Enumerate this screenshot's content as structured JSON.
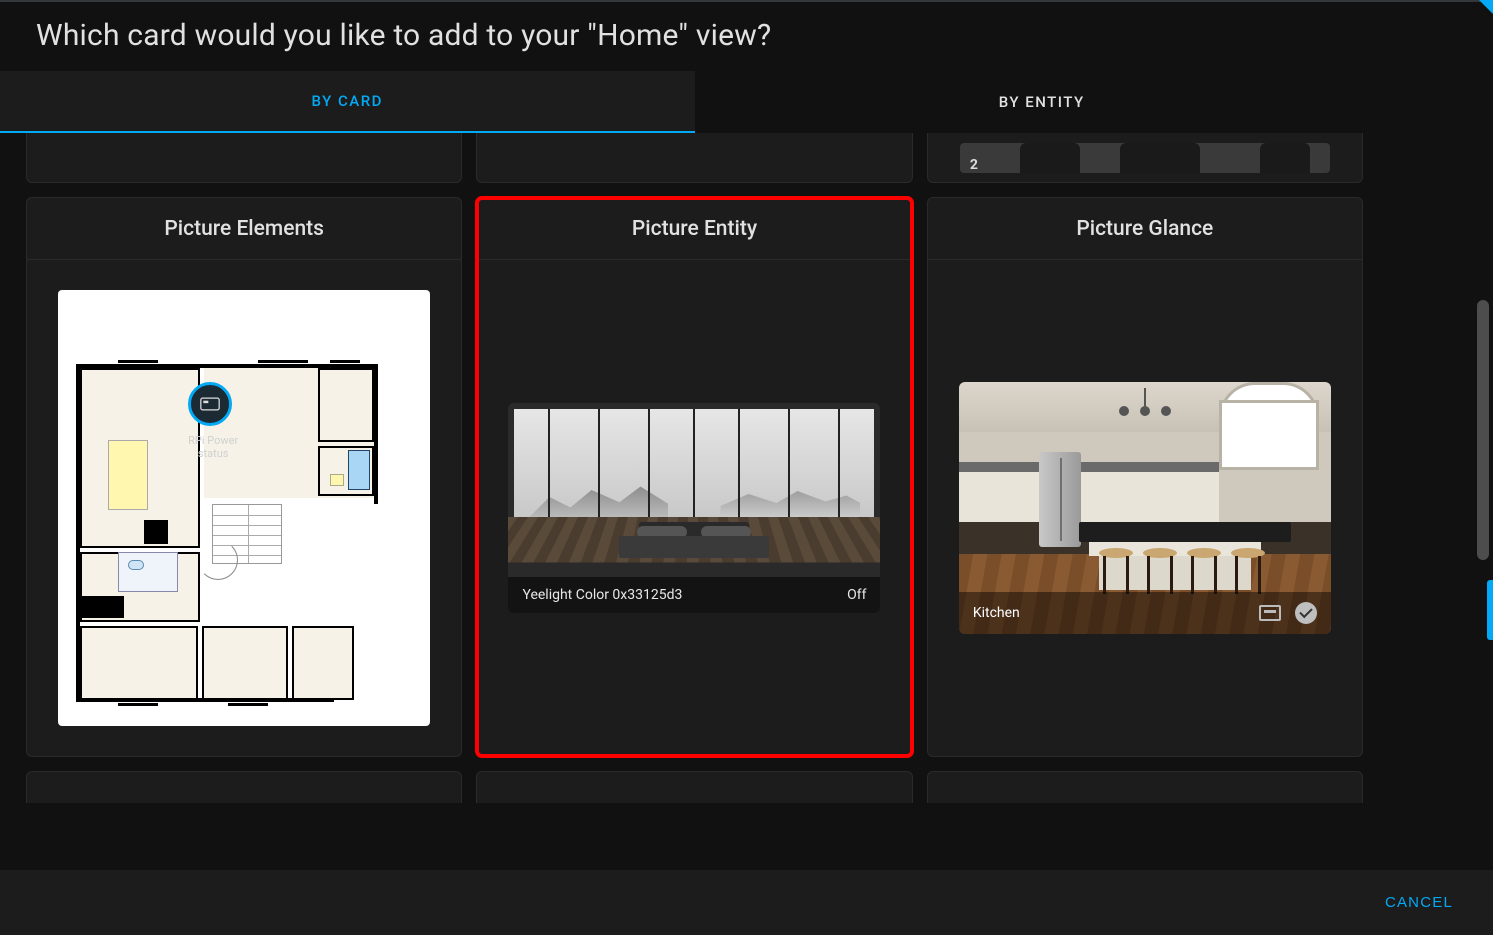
{
  "dialog": {
    "title": "Which card would you like to add to your \"Home\" view?"
  },
  "tabs": {
    "by_card": "BY CARD",
    "by_entity": "BY ENTITY",
    "active": "by_card"
  },
  "cards": {
    "picture_elements": {
      "title": "Picture Elements",
      "badge_label": "RPi Power status"
    },
    "picture_entity": {
      "title": "Picture Entity",
      "entity_name": "Yeelight Color 0x33125d3",
      "state": "Off"
    },
    "picture_glance": {
      "title": "Picture Glance",
      "room": "Kitchen"
    }
  },
  "footer": {
    "cancel": "CANCEL"
  },
  "prev_row_sports_number": "2"
}
